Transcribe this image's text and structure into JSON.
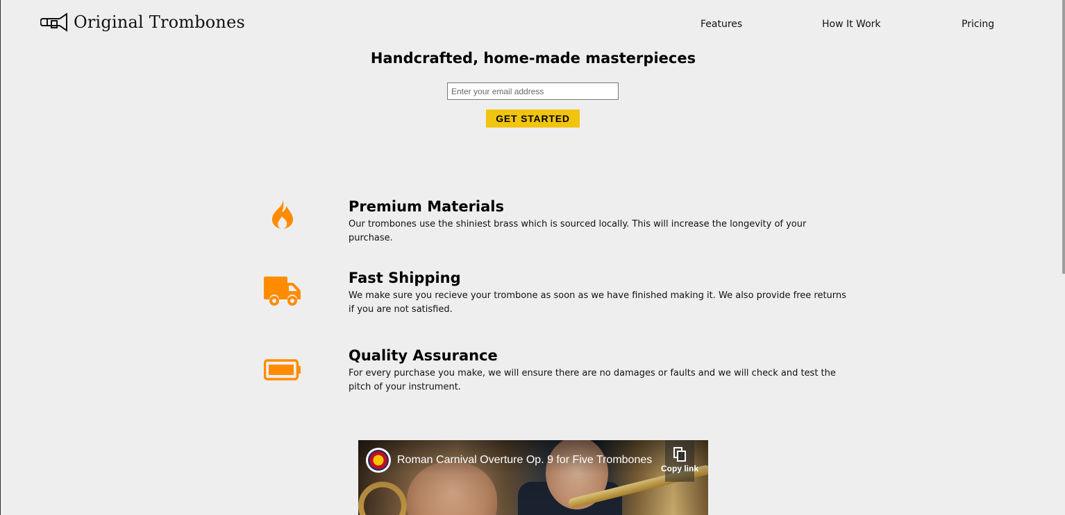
{
  "header": {
    "logo_text": "Original Trombones",
    "logo_icon": "trombone-icon",
    "nav": [
      {
        "label": "Features"
      },
      {
        "label": "How It Work"
      },
      {
        "label": "Pricing"
      }
    ]
  },
  "hero": {
    "title": "Handcrafted, home-made masterpieces",
    "email_placeholder": "Enter your email address",
    "cta_label": "GET STARTED"
  },
  "features": [
    {
      "icon": "fire-icon",
      "title": "Premium Materials",
      "description": "Our trombones use the shiniest brass which is sourced locally. This will increase the longevity of your purchase."
    },
    {
      "icon": "truck-icon",
      "title": "Fast Shipping",
      "description": "We make sure you recieve your trombone as soon as we have finished making it. We also provide free returns if you are not satisfied."
    },
    {
      "icon": "battery-full-icon",
      "title": "Quality Assurance",
      "description": "For every purchase you make, we will ensure there are no damages or faults and we will check and test the pitch of your instrument."
    }
  ],
  "video": {
    "title": "Roman Carnival Overture Op. 9 for Five Trombones",
    "copy_link_label": "Copy link"
  },
  "colors": {
    "background": "#eeeeee",
    "accent_icon": "#ff8c00",
    "cta_background": "#f1c40f"
  }
}
